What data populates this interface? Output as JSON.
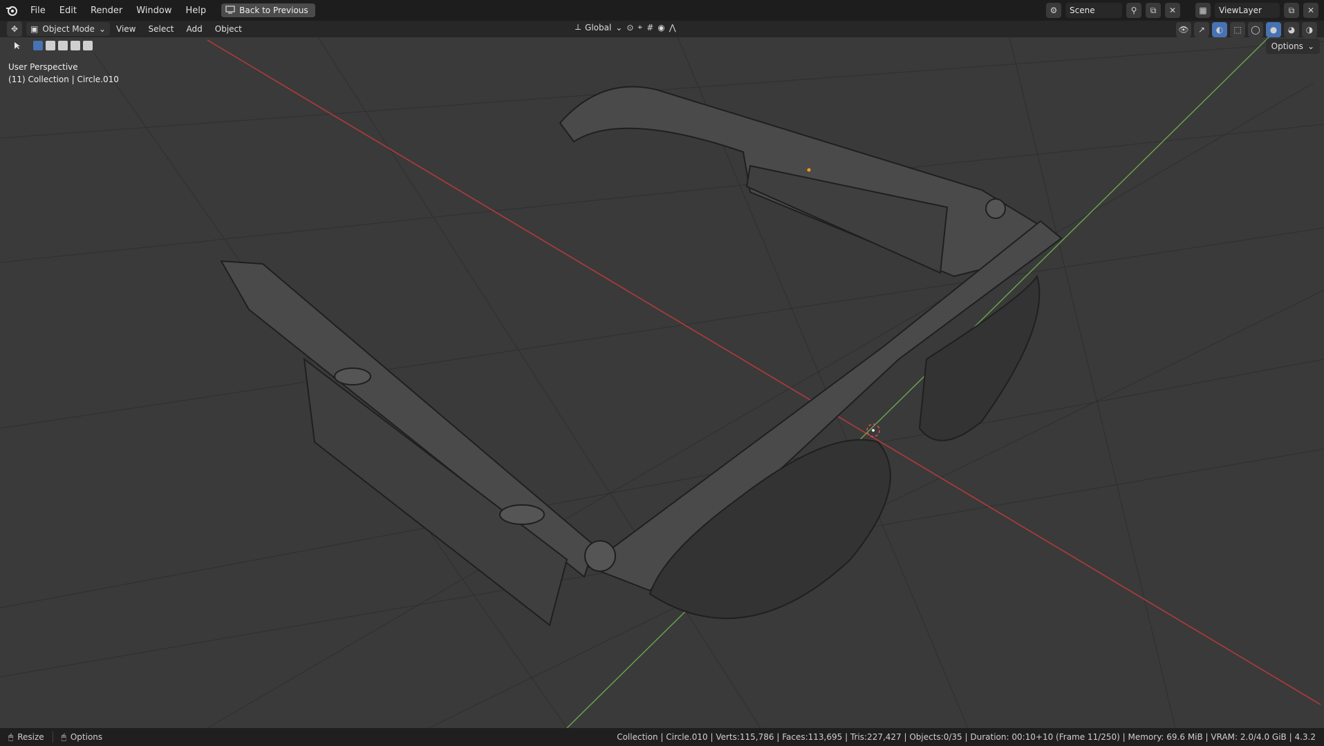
{
  "menu": {
    "file": "File",
    "edit": "Edit",
    "render": "Render",
    "window": "Window",
    "help": "Help"
  },
  "back_button": "Back to Previous",
  "scene": {
    "label": "Scene"
  },
  "view_layer": {
    "label": "ViewLayer"
  },
  "header": {
    "mode": "Object Mode",
    "view": "View",
    "select": "Select",
    "add": "Add",
    "object": "Object",
    "orientation": "Global",
    "options": "Options"
  },
  "viewport": {
    "perspective": "User Perspective",
    "collection_line": "(11) Collection | Circle.010"
  },
  "status": {
    "left1": "Resize",
    "left2": "Options",
    "right": "Collection | Circle.010 | Verts:115,786 | Faces:113,695 | Tris:227,427 | Objects:0/35 | Duration: 00:10+10 (Frame 11/250) | Memory: 69.6 MiB | VRAM: 2.0/4.0 GiB | 4.3.2"
  },
  "colors": {
    "x_axis": "#c0392b",
    "y_axis": "#6aa84f",
    "accent": "#4772b3"
  }
}
